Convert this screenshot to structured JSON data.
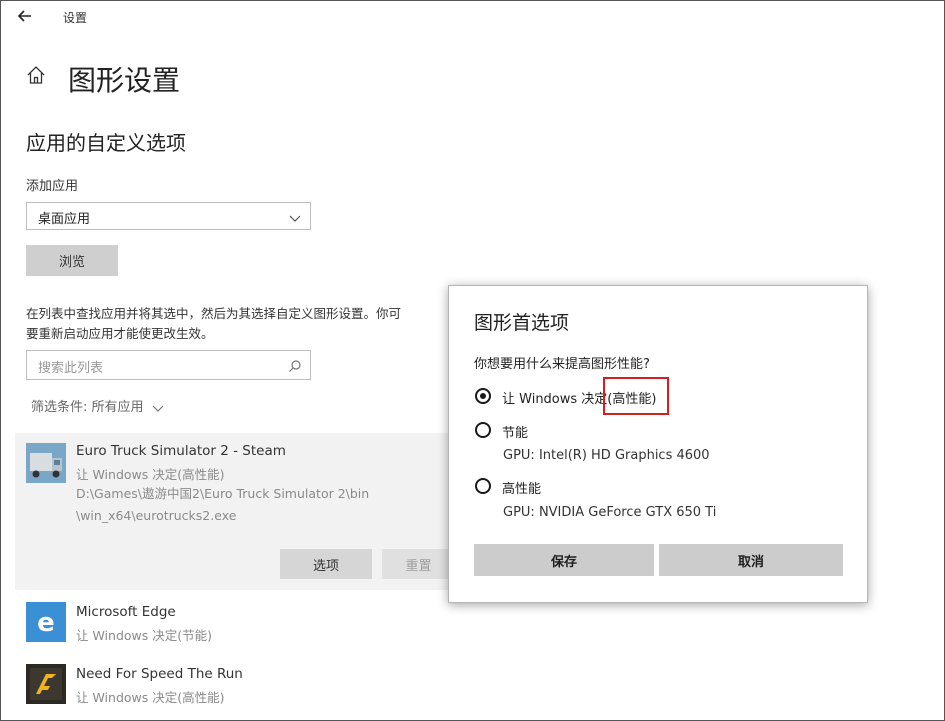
{
  "window": {
    "title": "设置"
  },
  "page": {
    "title": "图形设置",
    "section_title": "应用的自定义选项",
    "add_app_label": "添加应用",
    "app_type_selected": "桌面应用",
    "browse_label": "浏览",
    "description_line1": "在列表中查找应用并将其选中，然后为其选择自定义图形设置。你可",
    "description_line2": "要重新启动应用才能使更改生效。",
    "search_placeholder": "搜索此列表",
    "filter_label": "筛选条件: 所有应用"
  },
  "apps": [
    {
      "name": "Euro Truck Simulator 2 - Steam",
      "setting": "让 Windows 决定(高性能)",
      "path_line1": "D:\\Games\\遨游中国2\\Euro Truck Simulator 2\\bin",
      "path_line2": "\\win_x64\\eurotrucks2.exe",
      "options_label": "选项",
      "reset_label": "重置",
      "icon": "truck-icon"
    },
    {
      "name": "Microsoft Edge",
      "setting": "让 Windows 决定(节能)",
      "icon": "edge-icon"
    },
    {
      "name": "Need For Speed The Run",
      "setting": "让 Windows 决定(高性能)",
      "icon": "nfs-icon"
    }
  ],
  "dialog": {
    "title": "图形首选项",
    "question": "你想要用什么来提高图形性能?",
    "options": [
      {
        "label": "让 Windows 决定(高性能)",
        "selected": true
      },
      {
        "label": "节能",
        "sub": "GPU: Intel(R) HD Graphics 4600",
        "selected": false
      },
      {
        "label": "高性能",
        "sub": "GPU: NVIDIA GeForce GTX 650 Ti",
        "selected": false
      }
    ],
    "save_label": "保存",
    "cancel_label": "取消"
  },
  "colors": {
    "highlight_border": "#d02020",
    "edge_blue": "#3b8fd4",
    "selected_row_bg": "#f2f2f2"
  }
}
